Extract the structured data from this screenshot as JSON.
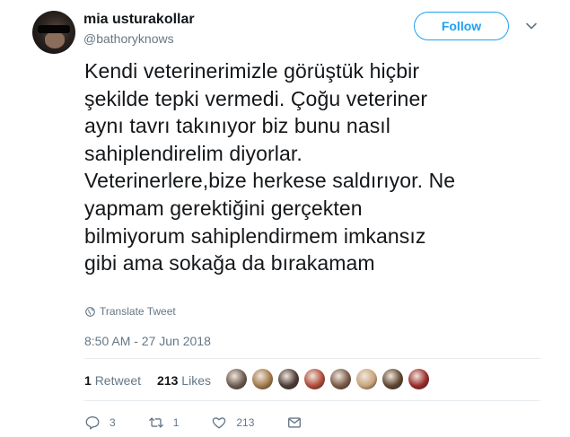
{
  "user": {
    "display_name": "mia usturakollar",
    "handle": "@bathoryknows"
  },
  "follow_button": {
    "label": "Follow"
  },
  "tweet": {
    "text": "Kendi veterinerimizle görüştük hiçbir\nşekilde tepki vermedi. Çoğu veteriner\naynı tavrı takınıyor biz bunu nasıl\nsahiplendirelim diyorlar.\nVeterinerlere,bize herkese saldırıyor. Ne\nyapmam gerektiğini gerçekten\nbilmiyorum sahiplendirmem imkansız\ngibi ama sokağa da bırakamam",
    "translate_label": "Translate Tweet",
    "timestamp": "8:50 AM - 27 Jun 2018"
  },
  "stats": {
    "retweet_count": "1",
    "retweet_label": "Retweet",
    "like_count": "213",
    "like_label": "Likes"
  },
  "liker_avatars": [
    {
      "name": "liker-avatar-1",
      "color": "#6b5a50"
    },
    {
      "name": "liker-avatar-2",
      "color": "#a27a4a"
    },
    {
      "name": "liker-avatar-3",
      "color": "#4a3b35"
    },
    {
      "name": "liker-avatar-4",
      "color": "#b04a3a"
    },
    {
      "name": "liker-avatar-5",
      "color": "#7a5a48"
    },
    {
      "name": "liker-avatar-6",
      "color": "#c9a47a"
    },
    {
      "name": "liker-avatar-7",
      "color": "#5e4630"
    },
    {
      "name": "liker-avatar-8",
      "color": "#9a2a2a"
    }
  ],
  "actions": {
    "reply_count": "3",
    "retweet_count": "1",
    "like_count": "213"
  },
  "colors": {
    "accent": "#1da1f2",
    "muted": "#657786",
    "text": "#14171a",
    "divider": "#e6ecf0"
  },
  "icons": {
    "caret": "chevron-down-icon",
    "translate": "globe-icon",
    "reply": "reply-icon",
    "retweet": "retweet-icon",
    "like": "heart-icon",
    "dm": "envelope-icon"
  }
}
